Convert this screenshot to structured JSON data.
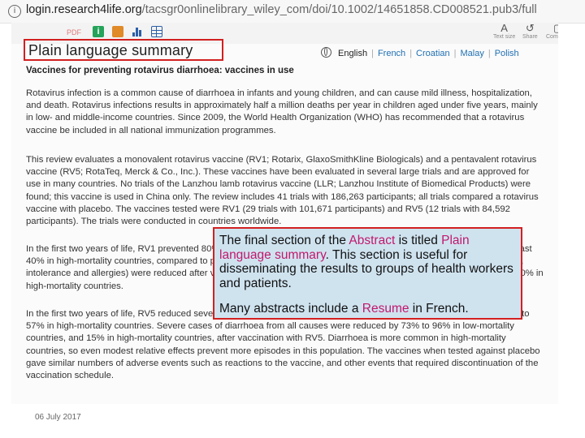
{
  "browser": {
    "url_host": "login.research4life.org",
    "url_path": "/tacsgr0onlinelibrary_wiley_com/doi/10.1002/14651858.CD008521.pub3/full",
    "info_icon": "info-icon"
  },
  "toolbar": {
    "pdf_label": "PDF",
    "info_glyph": "i",
    "icons": [
      "info-icon",
      "book-icon",
      "chart-icon",
      "table-icon"
    ],
    "text_size_label": "Text size",
    "share_label": "Share",
    "comment_label": "Comment"
  },
  "page": {
    "title": "Plain language summary",
    "languages": [
      "English",
      "French",
      "Croatian",
      "Malay",
      "Polish"
    ],
    "active_language": "English",
    "subtitle": "Vaccines for preventing rotavirus diarrhoea: vaccines in use",
    "paragraphs": [
      "Rotavirus infection is a common cause of diarrhoea in infants and young children, and can cause mild illness, hospitalization, and death. Rotavirus infections results in approximately half a million deaths per year in children aged under five years, mainly in low- and middle-income countries. Since 2009, the World Health Organization (WHO) has recommended that a rotavirus vaccine be included in all national immunization programmes.",
      "This review evaluates a monovalent rotavirus vaccine (RV1; Rotarix, GlaxoSmithKline Biologicals) and a pentavalent rotavirus vaccine (RV5; RotaTeq, Merck & Co., Inc.). These vaccines have been evaluated in several large trials and are approved for use in many countries. No trials of the Lanzhou lamb rotavirus vaccine (LLR; Lanzhou Institute of Biomedical Products) were found; this vaccine is used in China only. The review includes 41 trials with 186,263 participants; all trials compared a rotavirus vaccine with placebo. The vaccines tested were RV1 (29 trials with 101,671 participants) and RV5 (12 trials with 84,592 participants). The trials were conducted in countries worldwide.",
      "In the first two years of life, RV1 prevented 80% of severe cases of rotavirus diarrhoea in low-mortality countries, and at least 40% in high-mortality countries, compared to placebo. Severe cases of diarrhoea from all causes (including gastroenteritis, intolerance and allergies) were reduced after vaccination in low-mortality countries and, in high-mortality countries, up to 30% in high-mortality countries.",
      "In the first two years of life, RV5 reduced severe cases of rotavirus diarrhoea by 90% in low-mortality countries, and by 40 to 57% in high-mortality countries. Severe cases of diarrhoea from all causes were reduced by 73% to 96% in low-mortality countries, and 15% in high-mortality countries, after vaccination with RV5. Diarrhoea is more common in high-mortality countries, so even modest relative effects prevent more episodes in this population. The vaccines when tested against placebo gave similar numbers of adverse events such as reactions to the vaccine, and other events that required discontinuation of the vaccination schedule."
    ]
  },
  "callout": {
    "line1_a": "The final section of the ",
    "line1_hl": "Abstract",
    "line1_b": " is titled ",
    "line1_hl2": "Plain language summary",
    "line1_c": ". This section is useful for disseminating the results to groups of health workers and patients.",
    "line2_a": "Many abstracts include a ",
    "line2_hl": "Resume",
    "line2_b": " in French."
  },
  "footer": {
    "date": "06 July 2017"
  },
  "colors": {
    "callout_bg": "#cfe3ef",
    "highlight": "#c1186e",
    "border_red": "#d22020",
    "link_blue": "#1f6fb2"
  }
}
